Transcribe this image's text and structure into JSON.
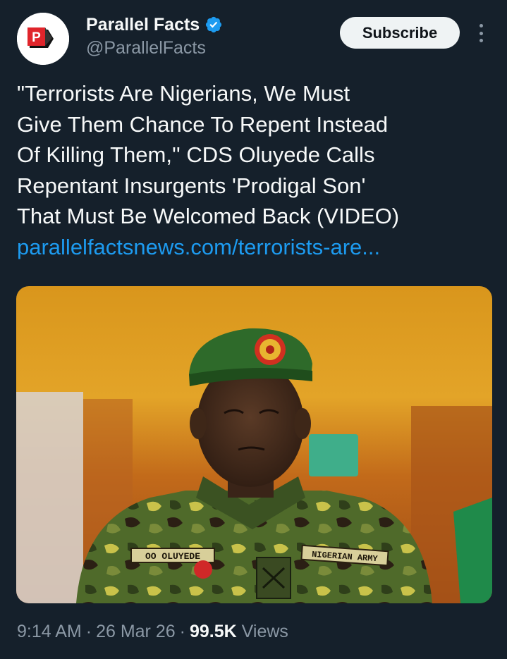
{
  "account": {
    "display_name": "Parallel Facts",
    "handle": "@ParallelFacts",
    "avatar_letter": "P",
    "verified": true
  },
  "actions": {
    "subscribe_label": "Subscribe",
    "more_icon": "more-vertical-icon"
  },
  "post": {
    "text_lines": [
      "\"Terrorists Are Nigerians, We Must",
      "Give Them Chance To Repent Instead",
      "Of Killing Them,'' CDS Oluyede Calls",
      "Repentant Insurgents 'Prodigal Son'",
      "That Must Be Welcomed Back (VIDEO)"
    ],
    "link": "parallelfactsnews.com/terrorists-are..."
  },
  "media": {
    "name_tag": "OO OLUYEDE",
    "unit_tag": "NIGERIAN ARMY"
  },
  "meta": {
    "time": "9:14 AM",
    "separator": "·",
    "date": "26 Mar 26",
    "views_count": "99.5K",
    "views_label": "Views"
  },
  "colors": {
    "background": "#15202b",
    "text": "#f7f9f9",
    "secondary": "#8b98a5",
    "link": "#1d9bf0",
    "brand_red": "#e0252b"
  }
}
